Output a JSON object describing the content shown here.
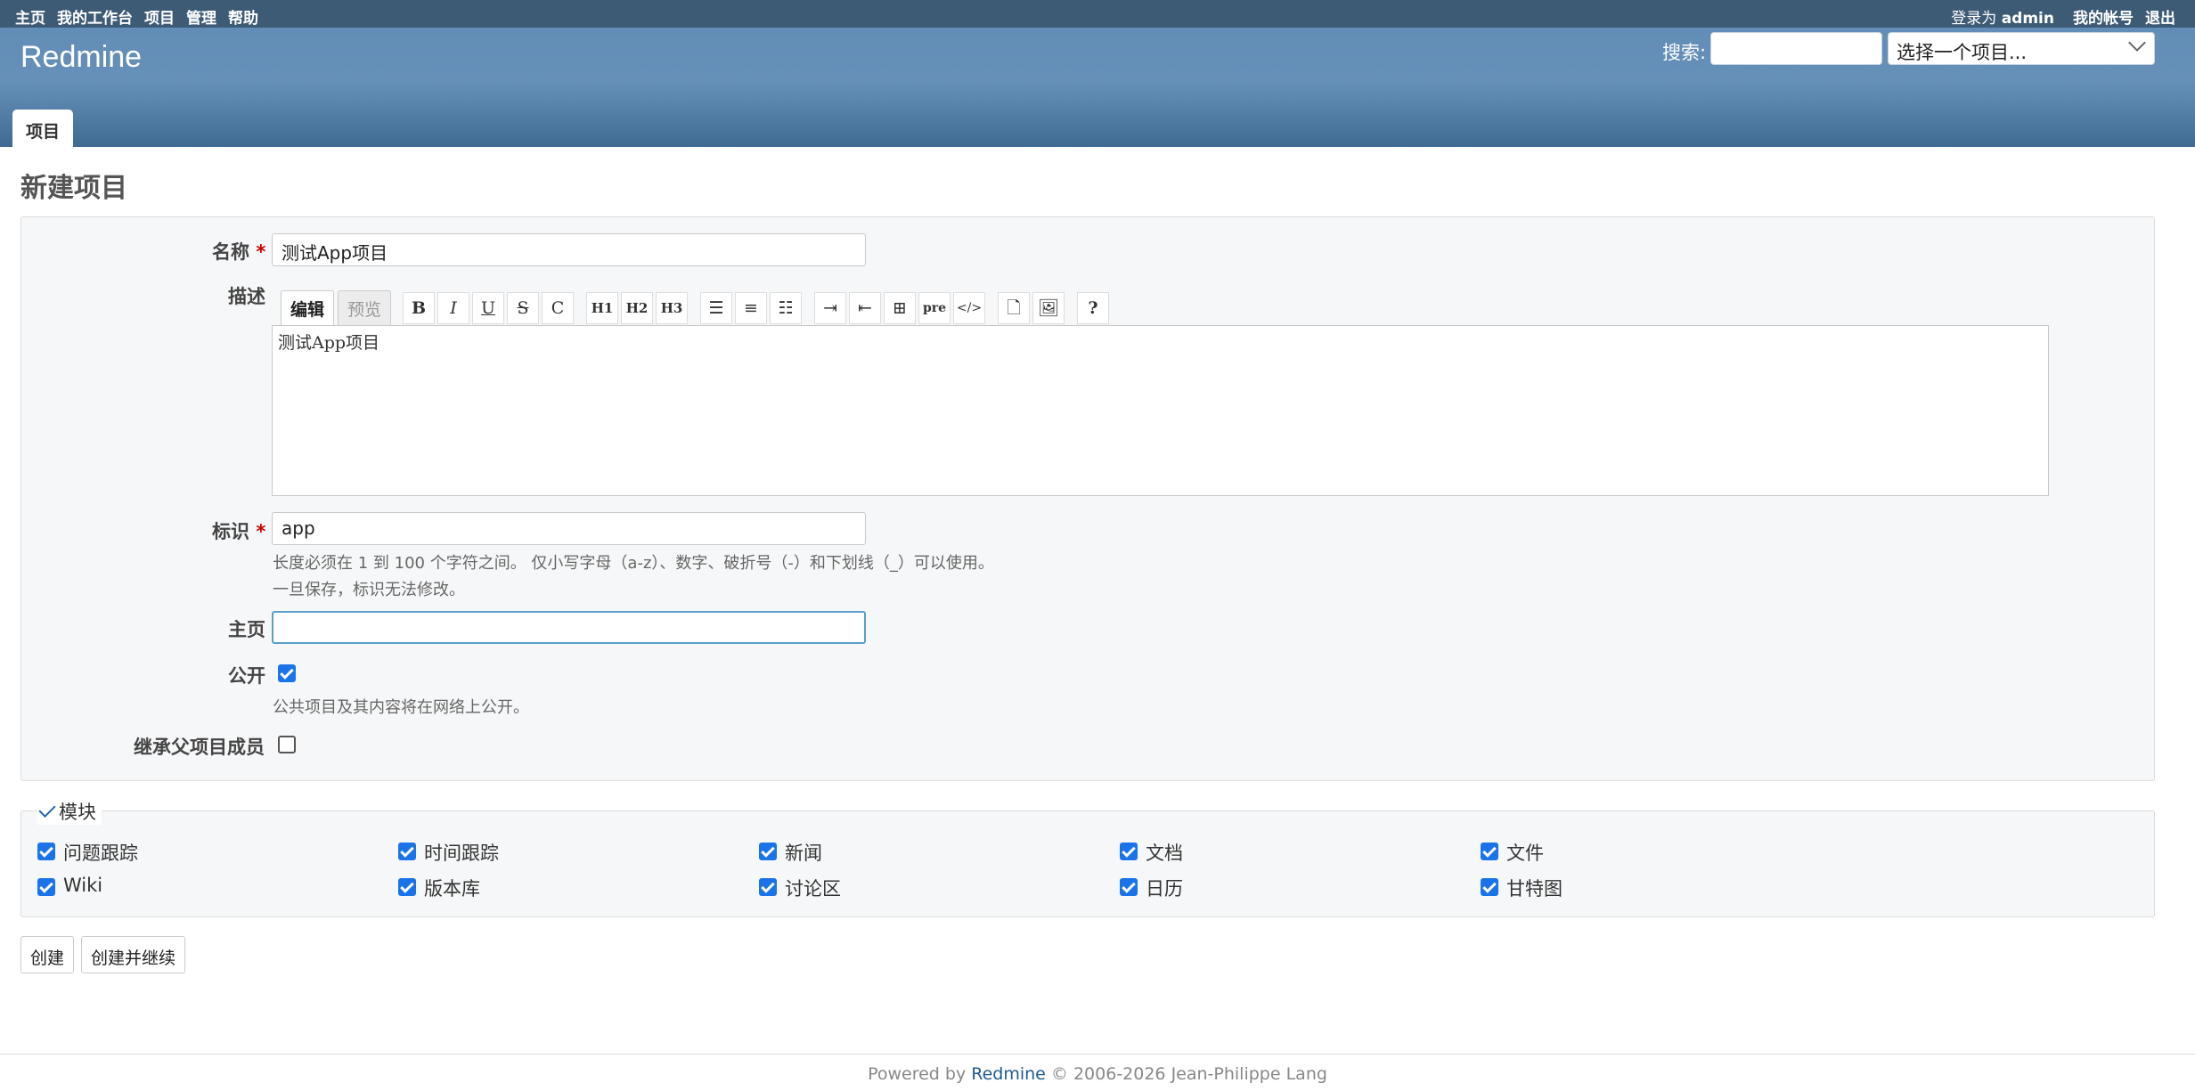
{
  "topmenu": {
    "left": [
      "主页",
      "我的工作台",
      "项目",
      "管理",
      "帮助"
    ],
    "login_prefix": "登录为",
    "login_user": "admin",
    "my_account": "我的帐号",
    "logout": "退出"
  },
  "header": {
    "brand": "Redmine",
    "search_label": "搜索:",
    "project_jump": "选择一个项目..."
  },
  "main_menu": {
    "tab": "项目"
  },
  "page": {
    "title": "新建项目"
  },
  "form": {
    "name_label": "名称",
    "name_value": "测试App项目",
    "required_mark": "*",
    "desc_label": "描述",
    "desc_tab_edit": "编辑",
    "desc_tab_preview": "预览",
    "desc_toolbar": [
      "B",
      "I",
      "U",
      "S",
      "C",
      "H1",
      "H2",
      "H3",
      "☰",
      "≡",
      "☷",
      "⇥",
      "⇤",
      "⊞",
      "pre",
      "</>",
      "🗋",
      "🖼",
      "?"
    ],
    "desc_value": "测试App项目",
    "ident_label": "标识",
    "ident_value": "app",
    "ident_hint1": "长度必须在 1 到 100 个字符之间。 仅小写字母（a-z）、数字、破折号（-）和下划线（_）可以使用。",
    "ident_hint2": "一旦保存，标识无法修改。",
    "homepage_label": "主页",
    "homepage_value": "",
    "public_label": "公开",
    "public_checked": true,
    "public_hint": "公共项目及其内容将在网络上公开。",
    "inherit_label": "继承父项目成员",
    "inherit_checked": false
  },
  "modules": {
    "legend": "模块",
    "items": [
      {
        "label": "问题跟踪",
        "checked": true
      },
      {
        "label": "时间跟踪",
        "checked": true
      },
      {
        "label": "新闻",
        "checked": true
      },
      {
        "label": "文档",
        "checked": true
      },
      {
        "label": "文件",
        "checked": true
      },
      {
        "label": "Wiki",
        "checked": true
      },
      {
        "label": "版本库",
        "checked": true
      },
      {
        "label": "讨论区",
        "checked": true
      },
      {
        "label": "日历",
        "checked": true
      },
      {
        "label": "甘特图",
        "checked": true
      }
    ]
  },
  "buttons": {
    "create": "创建",
    "create_continue": "创建并继续"
  },
  "footer": {
    "powered_by": "Powered by",
    "link": "Redmine",
    "copyright": "© 2006-2026 Jean-Philippe Lang"
  },
  "colors": {
    "topmenu": "#3e5b76",
    "header": "#628db6",
    "checkbox": "#1a73e8",
    "required": "#cc0000"
  }
}
